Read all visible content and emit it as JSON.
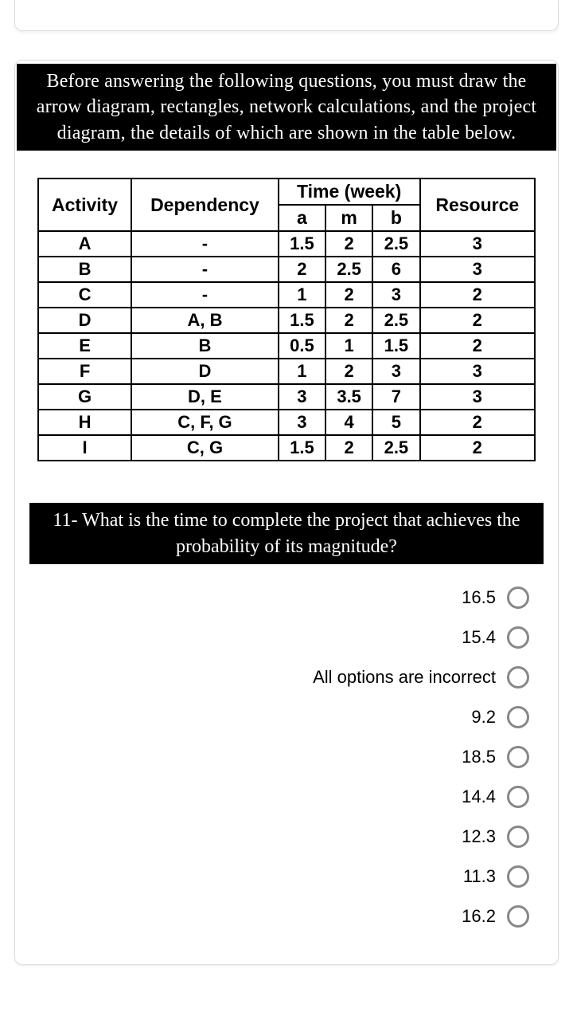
{
  "intro": {
    "text": "Before answering the following questions, you must draw the arrow diagram, rectangles, network calculations, and the project diagram, the details of which are shown in the table below."
  },
  "table": {
    "headers": {
      "activity": "Activity",
      "dependency": "Dependency",
      "time": "Time (week)",
      "a": "a",
      "m": "m",
      "b": "b",
      "resource": "Resource"
    },
    "rows": [
      {
        "activity": "A",
        "dependency": "-",
        "a": "1.5",
        "m": "2",
        "b": "2.5",
        "resource": "3"
      },
      {
        "activity": "B",
        "dependency": "-",
        "a": "2",
        "m": "2.5",
        "b": "6",
        "resource": "3"
      },
      {
        "activity": "C",
        "dependency": "-",
        "a": "1",
        "m": "2",
        "b": "3",
        "resource": "2"
      },
      {
        "activity": "D",
        "dependency": "A, B",
        "a": "1.5",
        "m": "2",
        "b": "2.5",
        "resource": "2"
      },
      {
        "activity": "E",
        "dependency": "B",
        "a": "0.5",
        "m": "1",
        "b": "1.5",
        "resource": "2"
      },
      {
        "activity": "F",
        "dependency": "D",
        "a": "1",
        "m": "2",
        "b": "3",
        "resource": "3"
      },
      {
        "activity": "G",
        "dependency": "D, E",
        "a": "3",
        "m": "3.5",
        "b": "7",
        "resource": "3"
      },
      {
        "activity": "H",
        "dependency": "C, F, G",
        "a": "3",
        "m": "4",
        "b": "5",
        "resource": "2"
      },
      {
        "activity": "I",
        "dependency": "C, G",
        "a": "1.5",
        "m": "2",
        "b": "2.5",
        "resource": "2"
      }
    ]
  },
  "question": {
    "text": "11- What is the time to complete the project that achieves the probability of its magnitude?"
  },
  "options": [
    {
      "label": "16.5"
    },
    {
      "label": "15.4"
    },
    {
      "label": "All options are incorrect"
    },
    {
      "label": "9.2"
    },
    {
      "label": "18.5"
    },
    {
      "label": "14.4"
    },
    {
      "label": "12.3"
    },
    {
      "label": "11.3"
    },
    {
      "label": "16.2"
    }
  ],
  "chart_data": {
    "type": "table",
    "title": "Activity time estimates and resources",
    "columns": [
      "Activity",
      "Dependency",
      "a",
      "m",
      "b",
      "Resource"
    ],
    "rows": [
      [
        "A",
        "-",
        1.5,
        2,
        2.5,
        3
      ],
      [
        "B",
        "-",
        2,
        2.5,
        6,
        3
      ],
      [
        "C",
        "-",
        1,
        2,
        3,
        2
      ],
      [
        "D",
        "A, B",
        1.5,
        2,
        2.5,
        2
      ],
      [
        "E",
        "B",
        0.5,
        1,
        1.5,
        2
      ],
      [
        "F",
        "D",
        1,
        2,
        3,
        3
      ],
      [
        "G",
        "D, E",
        3,
        3.5,
        7,
        3
      ],
      [
        "H",
        "C, F, G",
        3,
        4,
        5,
        2
      ],
      [
        "I",
        "C, G",
        1.5,
        2,
        2.5,
        2
      ]
    ]
  }
}
